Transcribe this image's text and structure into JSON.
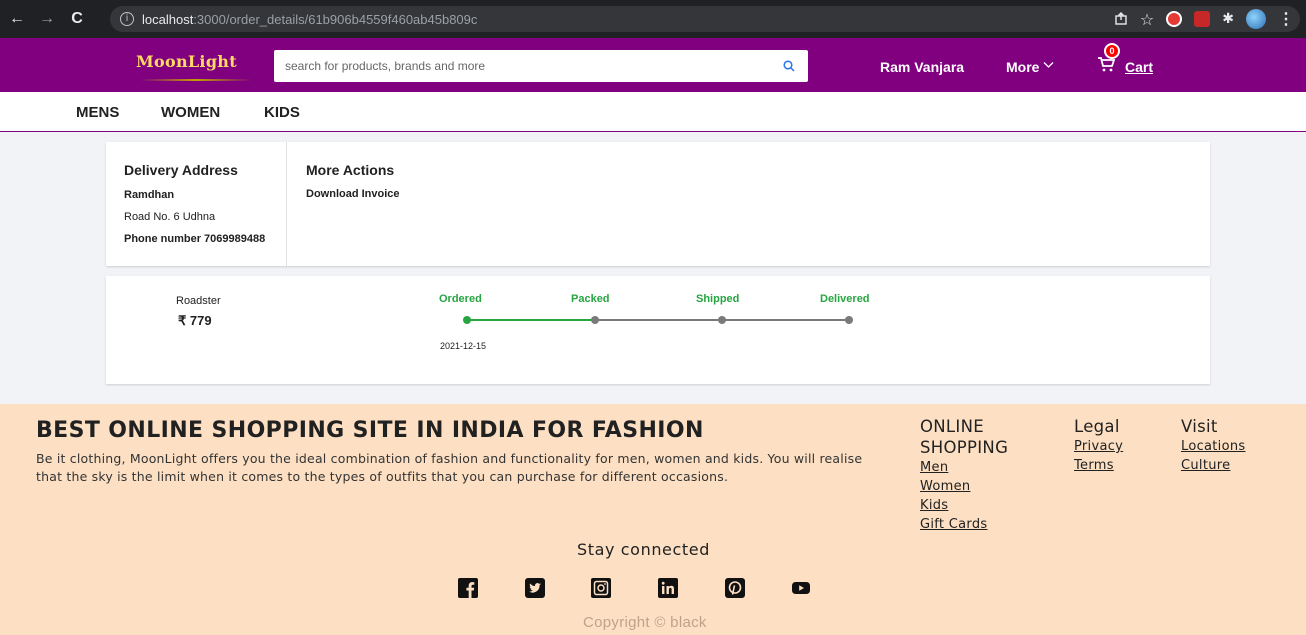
{
  "browser": {
    "url_host": "localhost",
    "url_path": ":3000/order_details/61b906b4559f460ab45b809c"
  },
  "header": {
    "logo": "MoonLight",
    "search_placeholder": "search for products, brands and more",
    "user_name": "Ram Vanjara",
    "more_label": "More",
    "cart_count": "0",
    "cart_label": "Cart",
    "brand_color": "#800080"
  },
  "categories": [
    "MENS",
    "WOMEN",
    "KIDS"
  ],
  "delivery": {
    "title": "Delivery Address",
    "name": "Ramdhan",
    "address": "Road No. 6 Udhna",
    "phone": "Phone number 7069989488"
  },
  "actions": {
    "title": "More Actions",
    "download": "Download Invoice"
  },
  "order_item": {
    "brand": "Roadster",
    "price": "₹ 779",
    "steps": [
      "Ordered",
      "Packed",
      "Shipped",
      "Delivered"
    ],
    "ordered_date": "2021-12-15",
    "completed_steps": 1,
    "status_color": "#26a541"
  },
  "footer": {
    "title": "BEST ONLINE SHOPPING SITE IN INDIA FOR FASHION",
    "description": "Be it clothing, MoonLight offers you the ideal combination of fashion and functionality for men, women and kids. You will realise that the sky is the limit when it comes to the types of outfits that you can purchase for different occasions.",
    "online_shopping": {
      "title": "ONLINE SHOPPING",
      "links": [
        "Men",
        "Women",
        "Kids",
        "Gift Cards"
      ]
    },
    "legal": {
      "title": "Legal",
      "links": [
        "Privacy",
        "Terms"
      ]
    },
    "visit": {
      "title": "Visit",
      "links": [
        "Locations",
        "Culture"
      ]
    },
    "stay_connected": "Stay connected",
    "social_icons": [
      "facebook-icon",
      "twitter-icon",
      "instagram-icon",
      "linkedin-icon",
      "pinterest-icon",
      "youtube-icon"
    ],
    "copyright": "Copyright © black"
  }
}
